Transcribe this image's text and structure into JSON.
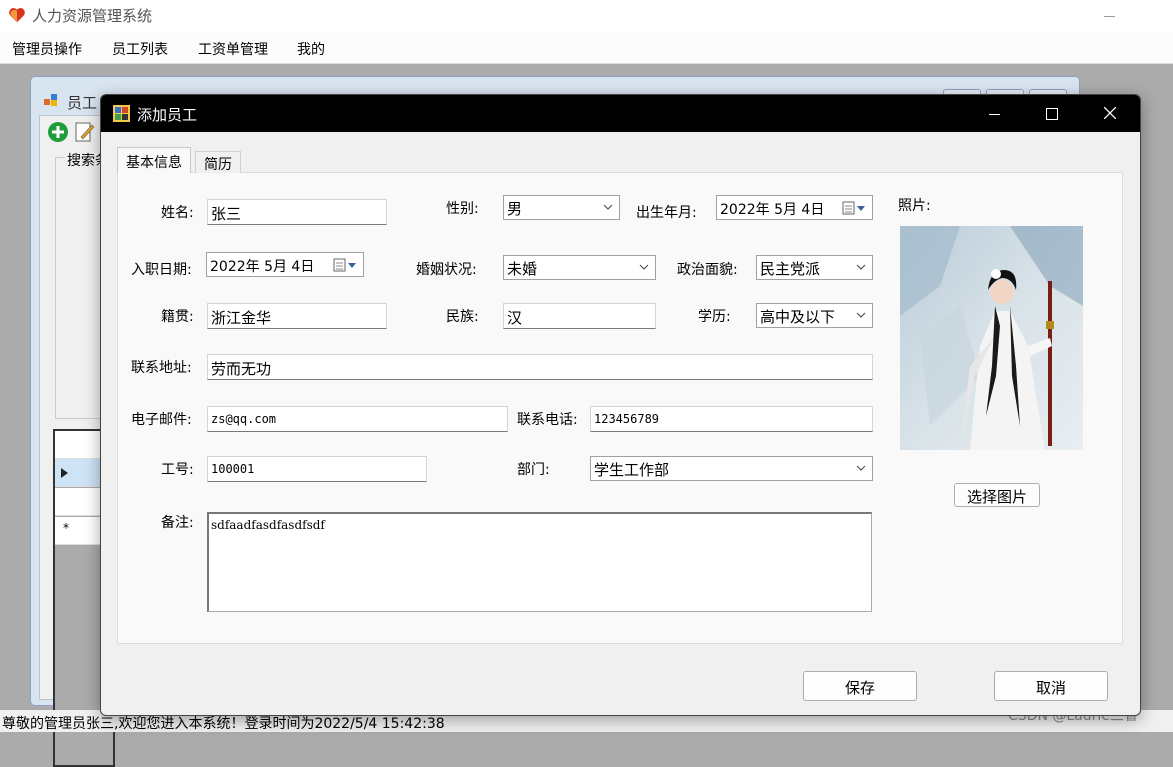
{
  "app": {
    "title": "人力资源管理系统"
  },
  "menu": [
    "管理员操作",
    "员工列表",
    "工资单管理",
    "我的"
  ],
  "background_window": {
    "title": "员工",
    "group_label": "搜索条"
  },
  "status": {
    "text": "尊敬的管理员张三,欢迎您进入本系统！登录时间为2022/5/4 15:42:38"
  },
  "watermark": "CSDN @Laurie三省",
  "dialog": {
    "title": "添加员工",
    "tabs": [
      "基本信息",
      "简历"
    ],
    "labels": {
      "name": "姓名:",
      "gender": "性别:",
      "birth": "出生年月:",
      "photo": "照片:",
      "hire_date": "入职日期:",
      "marital": "婚姻状况:",
      "political": "政治面貌:",
      "native_place": "籍贯:",
      "ethnicity": "民族:",
      "education": "学历:",
      "address": "联系地址:",
      "email": "电子邮件:",
      "phone": "联系电话:",
      "employee_id": "工号:",
      "department": "部门:",
      "notes": "备注:"
    },
    "values": {
      "name": "张三",
      "gender": "男",
      "birth": "2022年  5月  4日",
      "hire_date": "2022年  5月  4日",
      "marital": "未婚",
      "political": "民主党派",
      "native_place": "浙江金华",
      "ethnicity": "汉",
      "education": "高中及以下",
      "address": "劳而无功",
      "email": "zs@qq.com",
      "phone": "123456789",
      "employee_id": "100001",
      "department": "学生工作部",
      "notes": "sdfaadfasdfasdfsdf"
    },
    "buttons": {
      "select_photo": "选择图片",
      "save": "保存",
      "cancel": "取消"
    }
  }
}
